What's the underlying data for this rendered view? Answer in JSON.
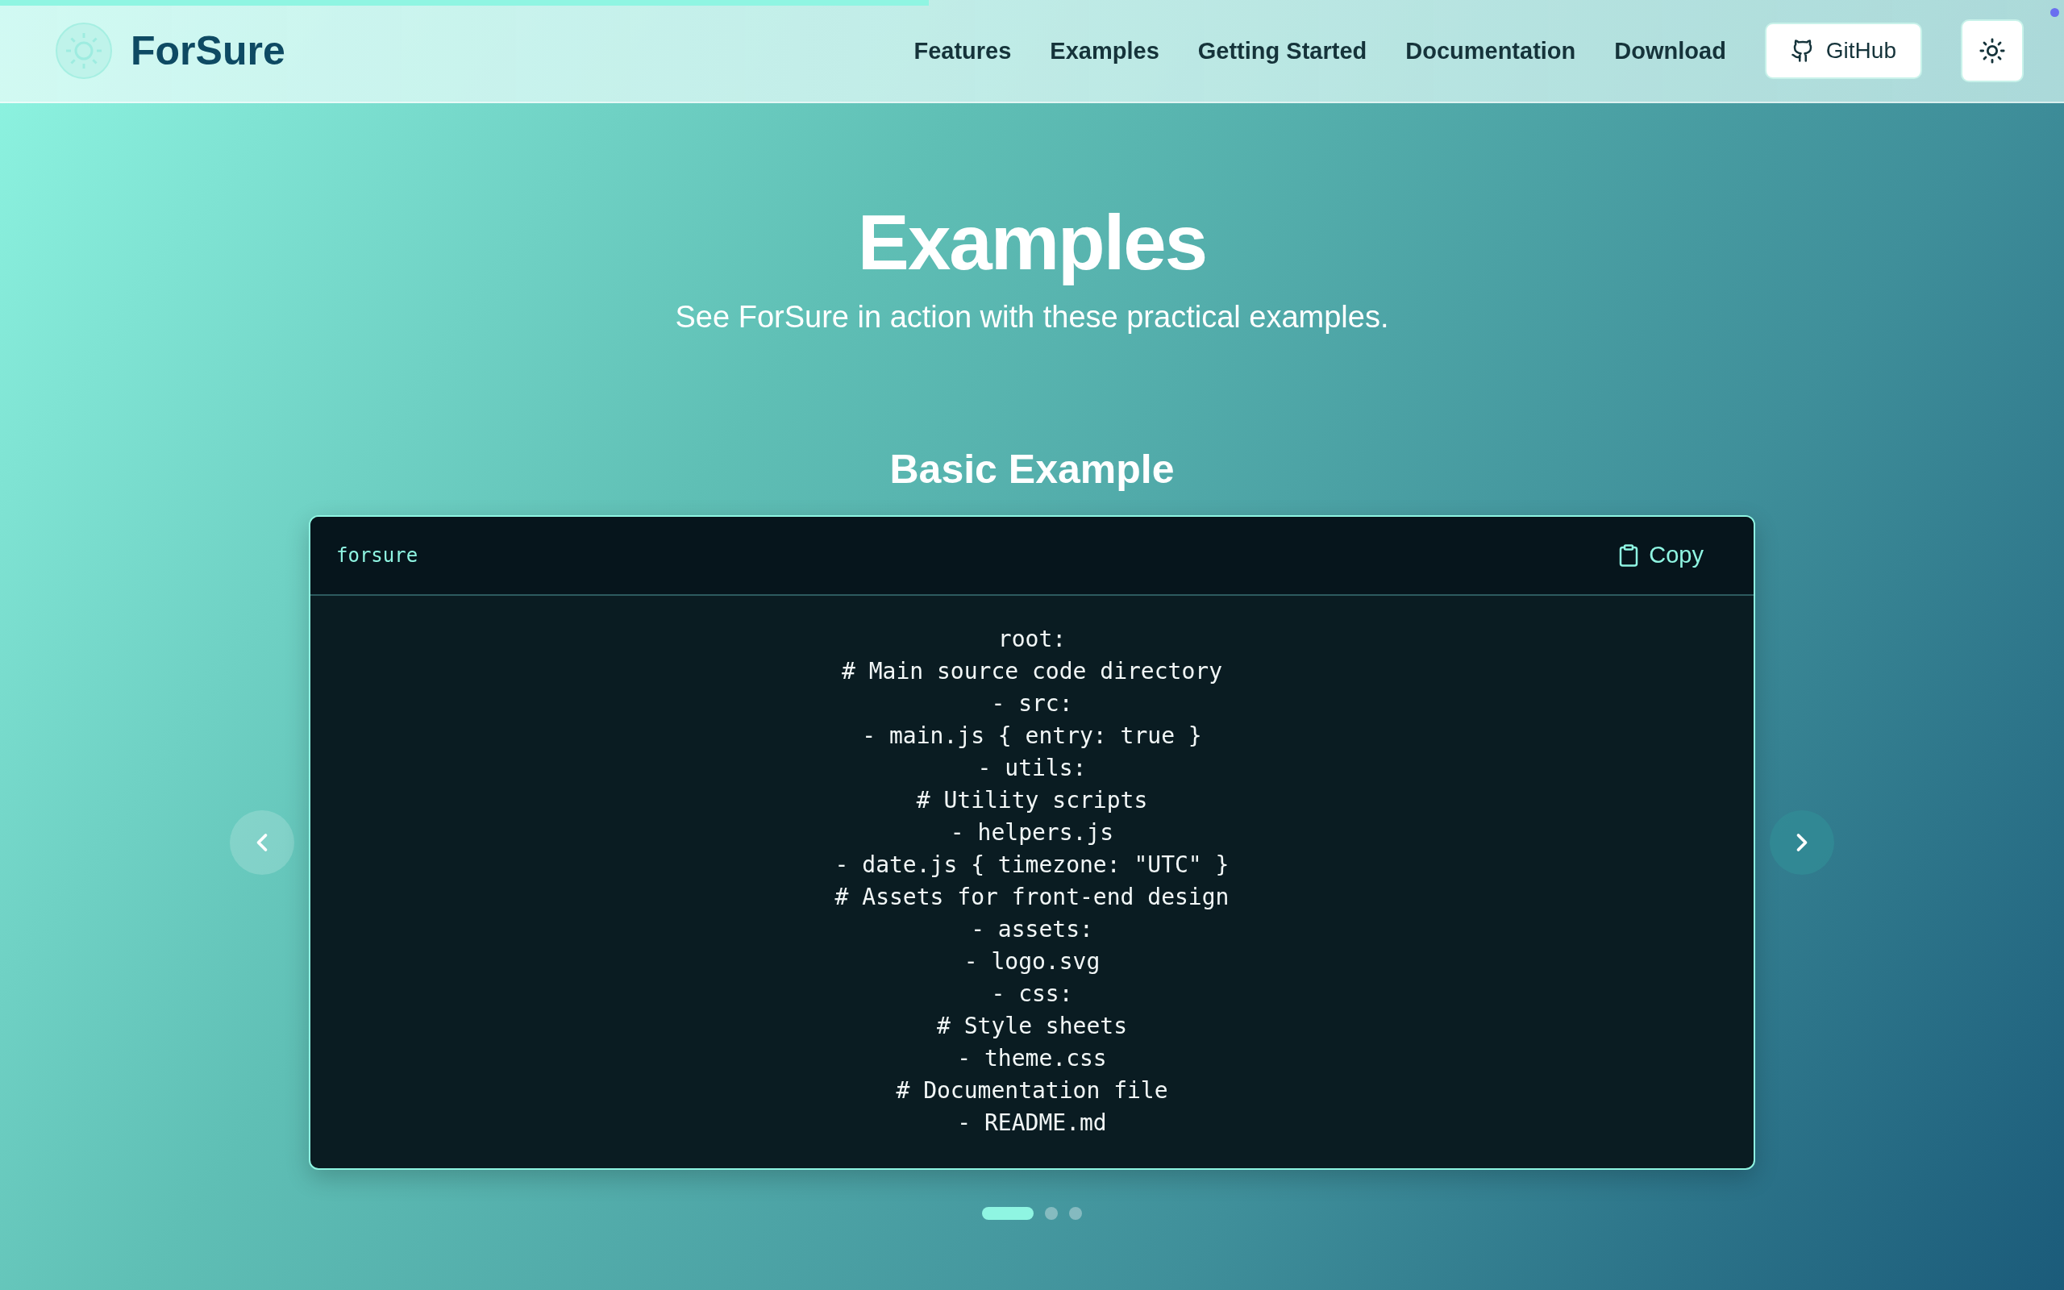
{
  "progress": {
    "level": 0.45
  },
  "header": {
    "logo": "ForSure",
    "nav": [
      "Features",
      "Examples",
      "Getting Started",
      "Documentation",
      "Download"
    ],
    "github_button": "GitHub"
  },
  "hero": {
    "title": "Examples",
    "subtitle": "See ForSure in action with these practical examples."
  },
  "example": {
    "title": "Basic Example",
    "language": "forsure",
    "copy_button": "Copy",
    "lines": [
      "root:",
      "# Main source code directory",
      "- src:",
      "- main.js { entry: true }",
      "- utils:",
      "# Utility scripts",
      "- helpers.js",
      "- date.js { timezone: \"UTC\" }",
      "# Assets for front-end design",
      "- assets:",
      "- logo.svg",
      "- css:",
      "# Style sheets",
      "- theme.css",
      "# Documentation file",
      "- README.md"
    ]
  },
  "carousel_dots": [
    {
      "selected": true
    },
    {
      "selected": false
    },
    {
      "selected": false
    }
  ]
}
